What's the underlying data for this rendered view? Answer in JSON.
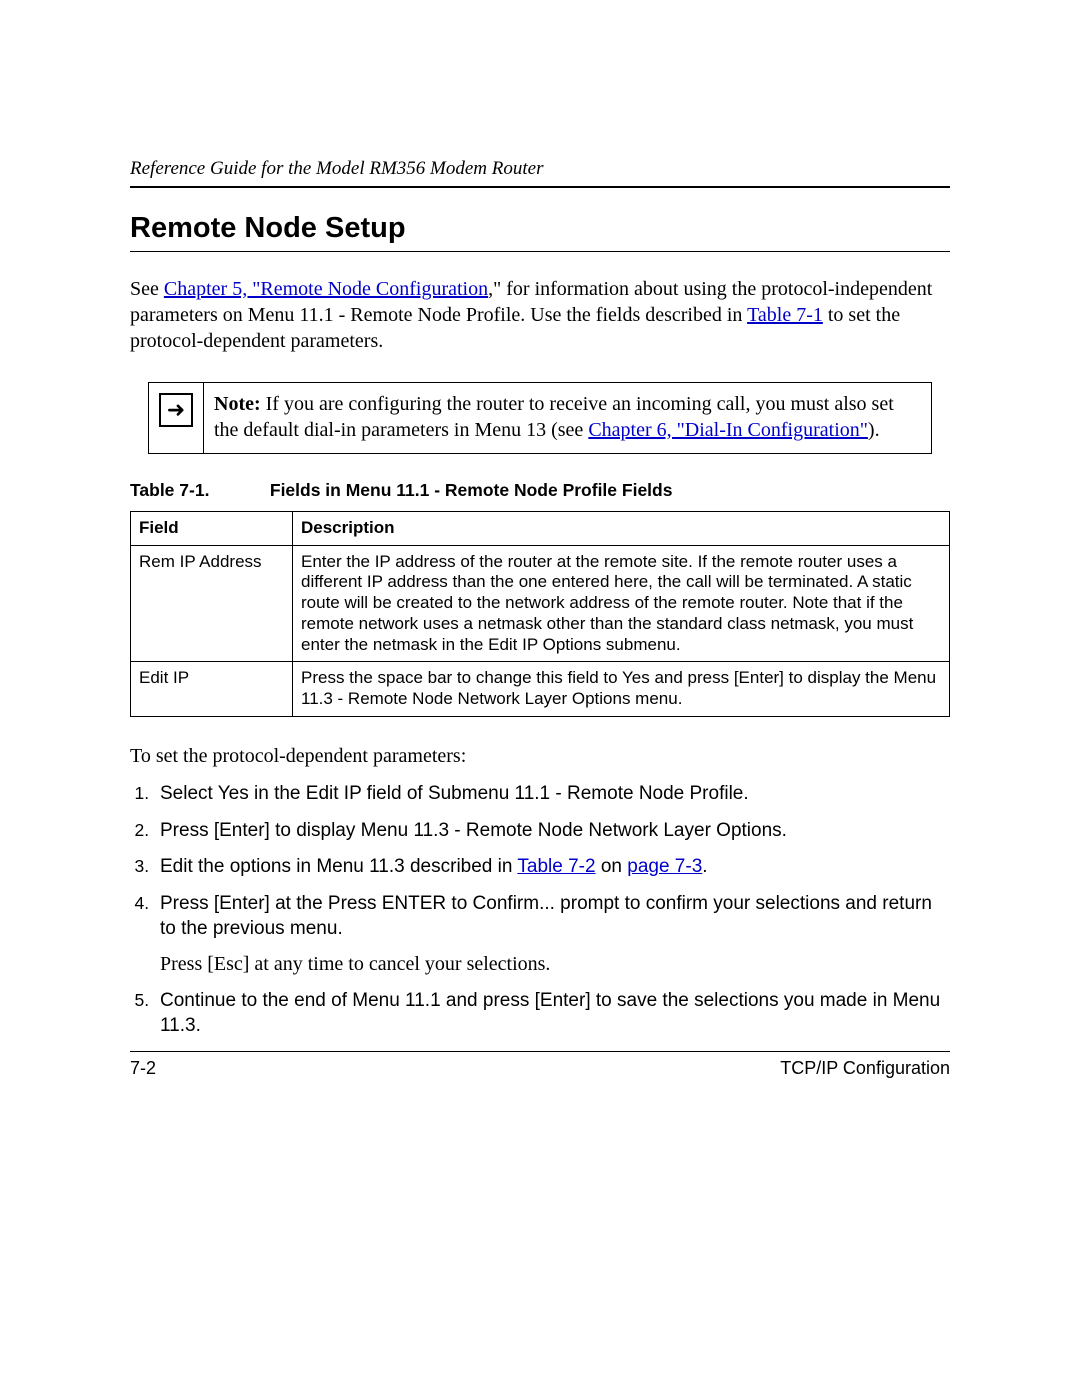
{
  "header": {
    "running_title": "Reference Guide for the Model RM356 Modem Router"
  },
  "section": {
    "title": "Remote Node Setup"
  },
  "intro": {
    "pre": "See ",
    "link1": "Chapter 5, \"Remote Node Configuration",
    "mid1": ",\" for information about using the protocol-independent parameters on Menu 11.1 - Remote Node Profile. Use the fields described in ",
    "link2": "Table 7-1",
    "end": " to set the protocol-dependent parameters."
  },
  "note": {
    "icon_glyph": "➜",
    "label": "Note:",
    "pre": " If you are configuring the router to receive an incoming call, you must also set the default dial-in parameters in Menu 13 (see ",
    "link": "Chapter 6, \"Dial-In Configuration\"",
    "post": ")."
  },
  "table": {
    "caption_label": "Table 7-1.",
    "caption_title": "Fields in Menu 11.1 - Remote Node Profile Fields",
    "headers": {
      "field": "Field",
      "description": "Description"
    },
    "rows": [
      {
        "field": "Rem IP Address",
        "description": "Enter the IP address of the router at the remote site. If the remote router uses a different IP address than the one entered here, the call will be terminated. A static route will be created to the network address of the remote router. Note that if the remote network uses a netmask other than the standard class netmask, you must enter the netmask in the Edit IP Options submenu."
      },
      {
        "field": "Edit IP",
        "description": "Press the space bar to change this field to Yes and press [Enter] to display the Menu 11.3 - Remote Node Network Layer Options menu."
      }
    ]
  },
  "steps_intro": "To set the protocol-dependent parameters:",
  "steps": [
    {
      "text": "Select Yes in the Edit IP field of Submenu 11.1 - Remote Node Profile."
    },
    {
      "text": "Press [Enter] to display Menu 11.3 - Remote Node Network Layer Options."
    },
    {
      "pre": "Edit the options in Menu 11.3 described in ",
      "link1": "Table 7-2",
      "mid": " on ",
      "link2": "page 7-3",
      "post": "."
    },
    {
      "text": "Press [Enter] at the Press ENTER to Confirm... prompt to confirm your selections and return to the previous menu.",
      "subtext": "Press [Esc] at any time to cancel your selections."
    },
    {
      "text": "Continue to the end of Menu 11.1 and press [Enter] to save the selections you made in Menu 11.3."
    }
  ],
  "footer": {
    "page": "7-2",
    "chapter": "TCP/IP Configuration"
  }
}
